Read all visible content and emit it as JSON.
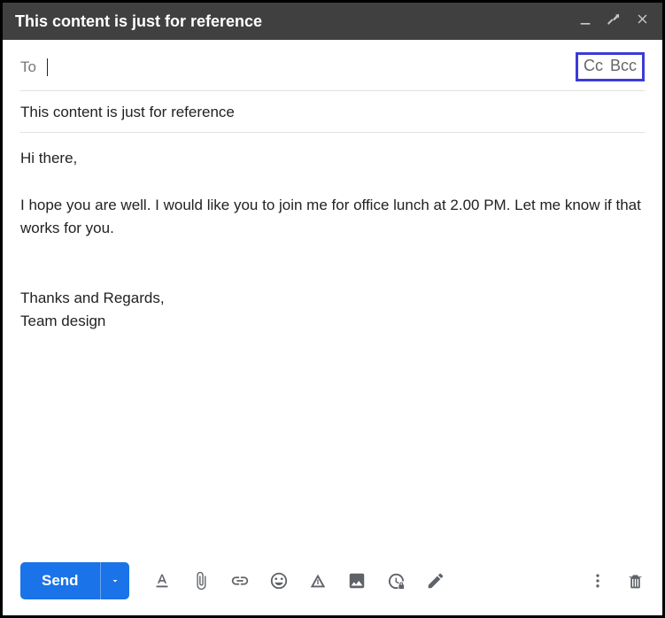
{
  "window": {
    "title": "This content is just for reference"
  },
  "recipients": {
    "to_label": "To",
    "to_value": "",
    "cc_label": "Cc",
    "bcc_label": "Bcc"
  },
  "subject": "This content is just for reference",
  "body": {
    "greeting": "Hi there,",
    "para1": "I hope you are well. I would like you to join me for office lunch at 2.00 PM. Let me know if that works for you.",
    "signoff1": "Thanks and Regards,",
    "signoff2": "Team design"
  },
  "actions": {
    "send_label": "Send"
  },
  "icons": {
    "minimize": "minimize",
    "expand": "expand",
    "close": "close",
    "format": "text-format",
    "attach": "paperclip",
    "link": "link",
    "emoji": "smiley",
    "drive": "drive-triangle",
    "image": "image",
    "confidential": "clock-lock",
    "pen": "pen",
    "more": "kebab",
    "trash": "trash"
  }
}
